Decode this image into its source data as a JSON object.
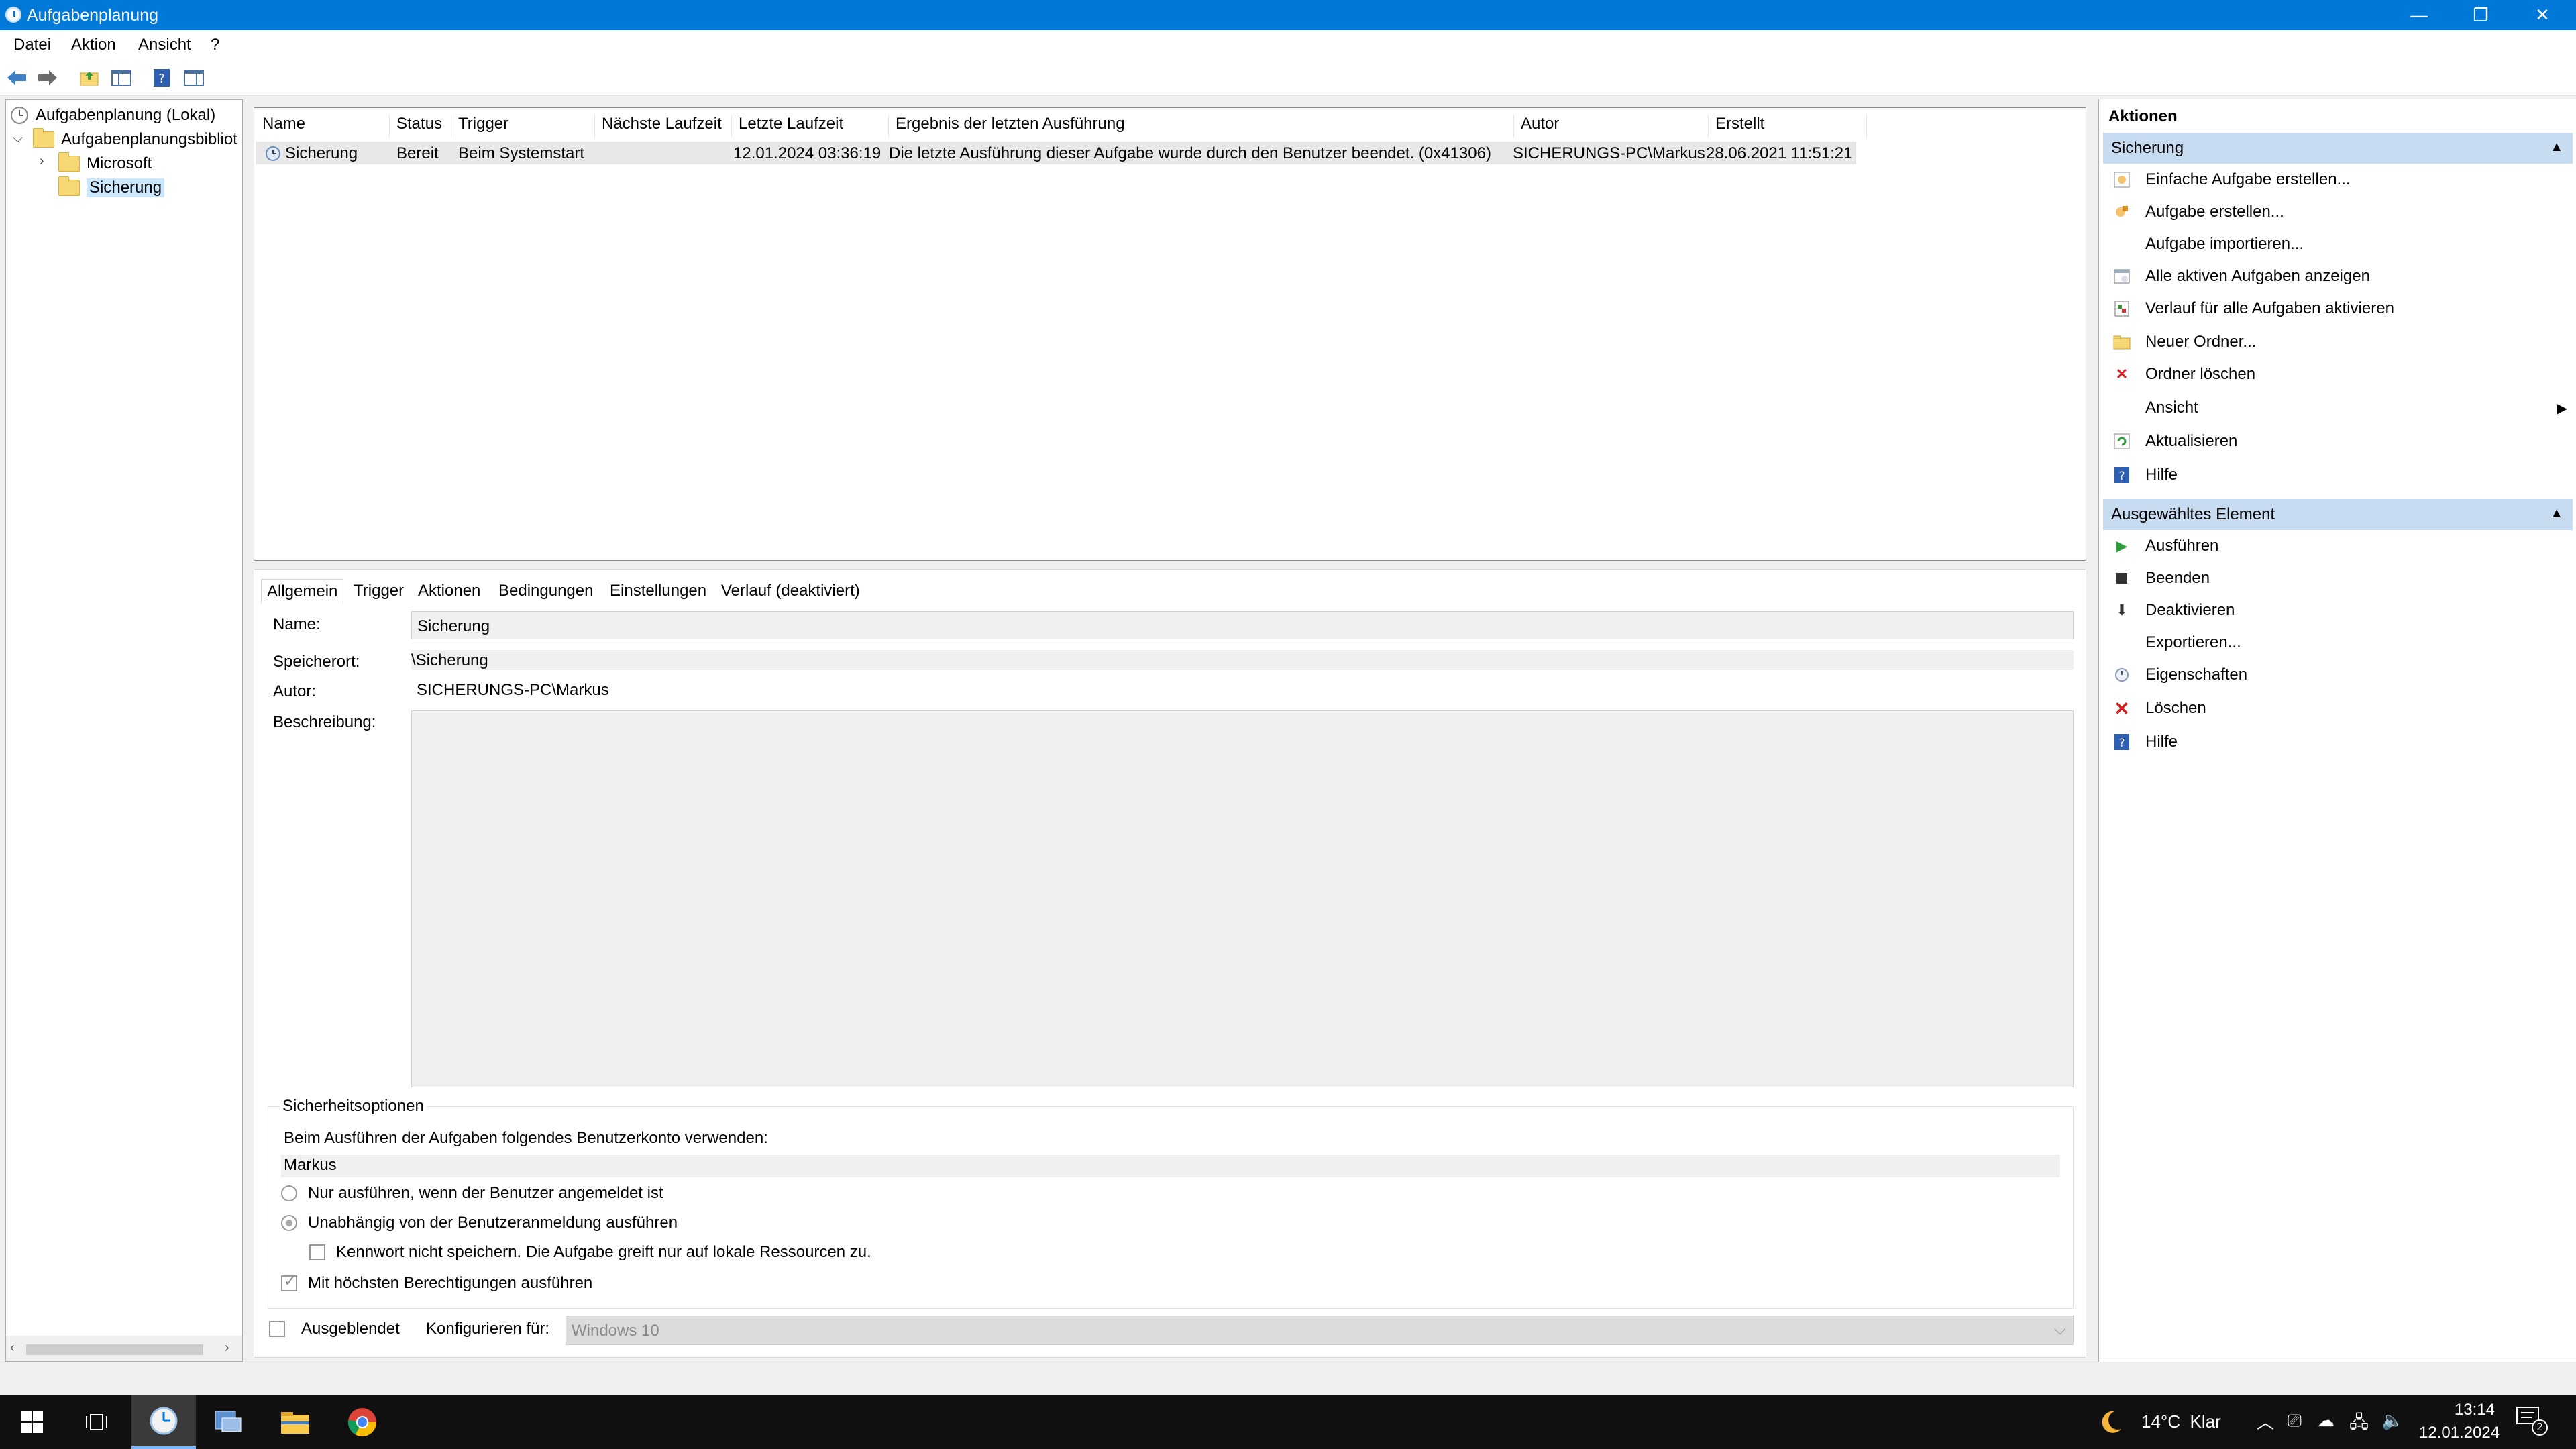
{
  "window": {
    "title": "Aufgabenplanung",
    "minimize_glyph": "—",
    "restore_glyph": "❐",
    "close_glyph": "✕"
  },
  "menu": {
    "items": [
      "Datei",
      "Aktion",
      "Ansicht",
      "?"
    ]
  },
  "toolbar": {
    "icons": [
      "back-arrow-icon",
      "forward-arrow-icon",
      "up-folder-icon",
      "show-hide-tree-icon",
      "help-icon",
      "show-hide-action-pane-icon"
    ]
  },
  "tree": {
    "root": "Aufgabenplanung (Lokal)",
    "library": "Aufgabenplanungsbibliot",
    "children": [
      "Microsoft",
      "Sicherung"
    ],
    "selected": "Sicherung"
  },
  "tasklist": {
    "columns": [
      "Name",
      "Status",
      "Trigger",
      "Nächste Laufzeit",
      "Letzte Laufzeit",
      "Ergebnis der letzten Ausführung",
      "Autor",
      "Erstellt"
    ],
    "rows": [
      {
        "name": "Sicherung",
        "status": "Bereit",
        "trigger": "Beim Systemstart",
        "next": "",
        "last": "12.01.2024 03:36:19",
        "result": "Die letzte Ausführung dieser Aufgabe wurde durch den Benutzer beendet. (0x41306)",
        "author": "SICHERUNGS-PC\\Markus",
        "created": "28.06.2021 11:51:21"
      }
    ]
  },
  "details": {
    "tabs": [
      "Allgemein",
      "Trigger",
      "Aktionen",
      "Bedingungen",
      "Einstellungen",
      "Verlauf (deaktiviert)"
    ],
    "active_tab": "Allgemein",
    "name_label": "Name:",
    "name_value": "Sicherung",
    "location_label": "Speicherort:",
    "location_value": "\\Sicherung",
    "author_label": "Autor:",
    "author_value": "SICHERUNGS-PC\\Markus",
    "description_label": "Beschreibung:",
    "description_value": "",
    "security": {
      "title": "Sicherheitsoptionen",
      "account_label": "Beim Ausführen der Aufgaben folgendes Benutzerkonto verwenden:",
      "account_value": "Markus",
      "radio_logged_on": "Nur ausführen, wenn der Benutzer angemeldet ist",
      "radio_independent": "Unabhängig von der Benutzeranmeldung ausführen",
      "no_password": "Kennwort nicht speichern. Die Aufgabe greift nur auf lokale Ressourcen zu.",
      "highest_privileges": "Mit höchsten Berechtigungen ausführen"
    },
    "hidden_label": "Ausgeblendet",
    "configure_label": "Konfigurieren für:",
    "configure_value": "Windows 10"
  },
  "actions": {
    "header": "Aktionen",
    "section1": "Sicherung",
    "items1": [
      {
        "label": "Einfache Aufgabe erstellen...",
        "icon": "wizard-icon"
      },
      {
        "label": "Aufgabe erstellen...",
        "icon": "create-task-icon"
      },
      {
        "label": "Aufgabe importieren...",
        "icon": ""
      },
      {
        "label": "Alle aktiven Aufgaben anzeigen",
        "icon": "running-tasks-icon"
      },
      {
        "label": "Verlauf für alle Aufgaben aktivieren",
        "icon": "history-icon"
      },
      {
        "label": "Neuer Ordner...",
        "icon": "new-folder-icon"
      },
      {
        "label": "Ordner löschen",
        "icon": "delete-folder-icon"
      },
      {
        "label": "Ansicht",
        "icon": ""
      },
      {
        "label": "Aktualisieren",
        "icon": "refresh-icon"
      },
      {
        "label": "Hilfe",
        "icon": "help-icon"
      }
    ],
    "section2": "Ausgewähltes Element",
    "items2": [
      {
        "label": "Ausführen",
        "icon": "run-icon"
      },
      {
        "label": "Beenden",
        "icon": "stop-icon"
      },
      {
        "label": "Deaktivieren",
        "icon": "disable-icon"
      },
      {
        "label": "Exportieren...",
        "icon": ""
      },
      {
        "label": "Eigenschaften",
        "icon": "properties-icon"
      },
      {
        "label": "Löschen",
        "icon": "delete-icon"
      },
      {
        "label": "Hilfe",
        "icon": "help-icon"
      }
    ]
  },
  "taskbar": {
    "weather": "14°C  Klar",
    "time": "13:14",
    "date": "12.01.2024",
    "notification_count": "2"
  },
  "colors": {
    "titlebar": "#0078d7",
    "section_header": "#c7dcf0",
    "selected_row": "#e8e8e8",
    "taskbar": "#101010"
  }
}
